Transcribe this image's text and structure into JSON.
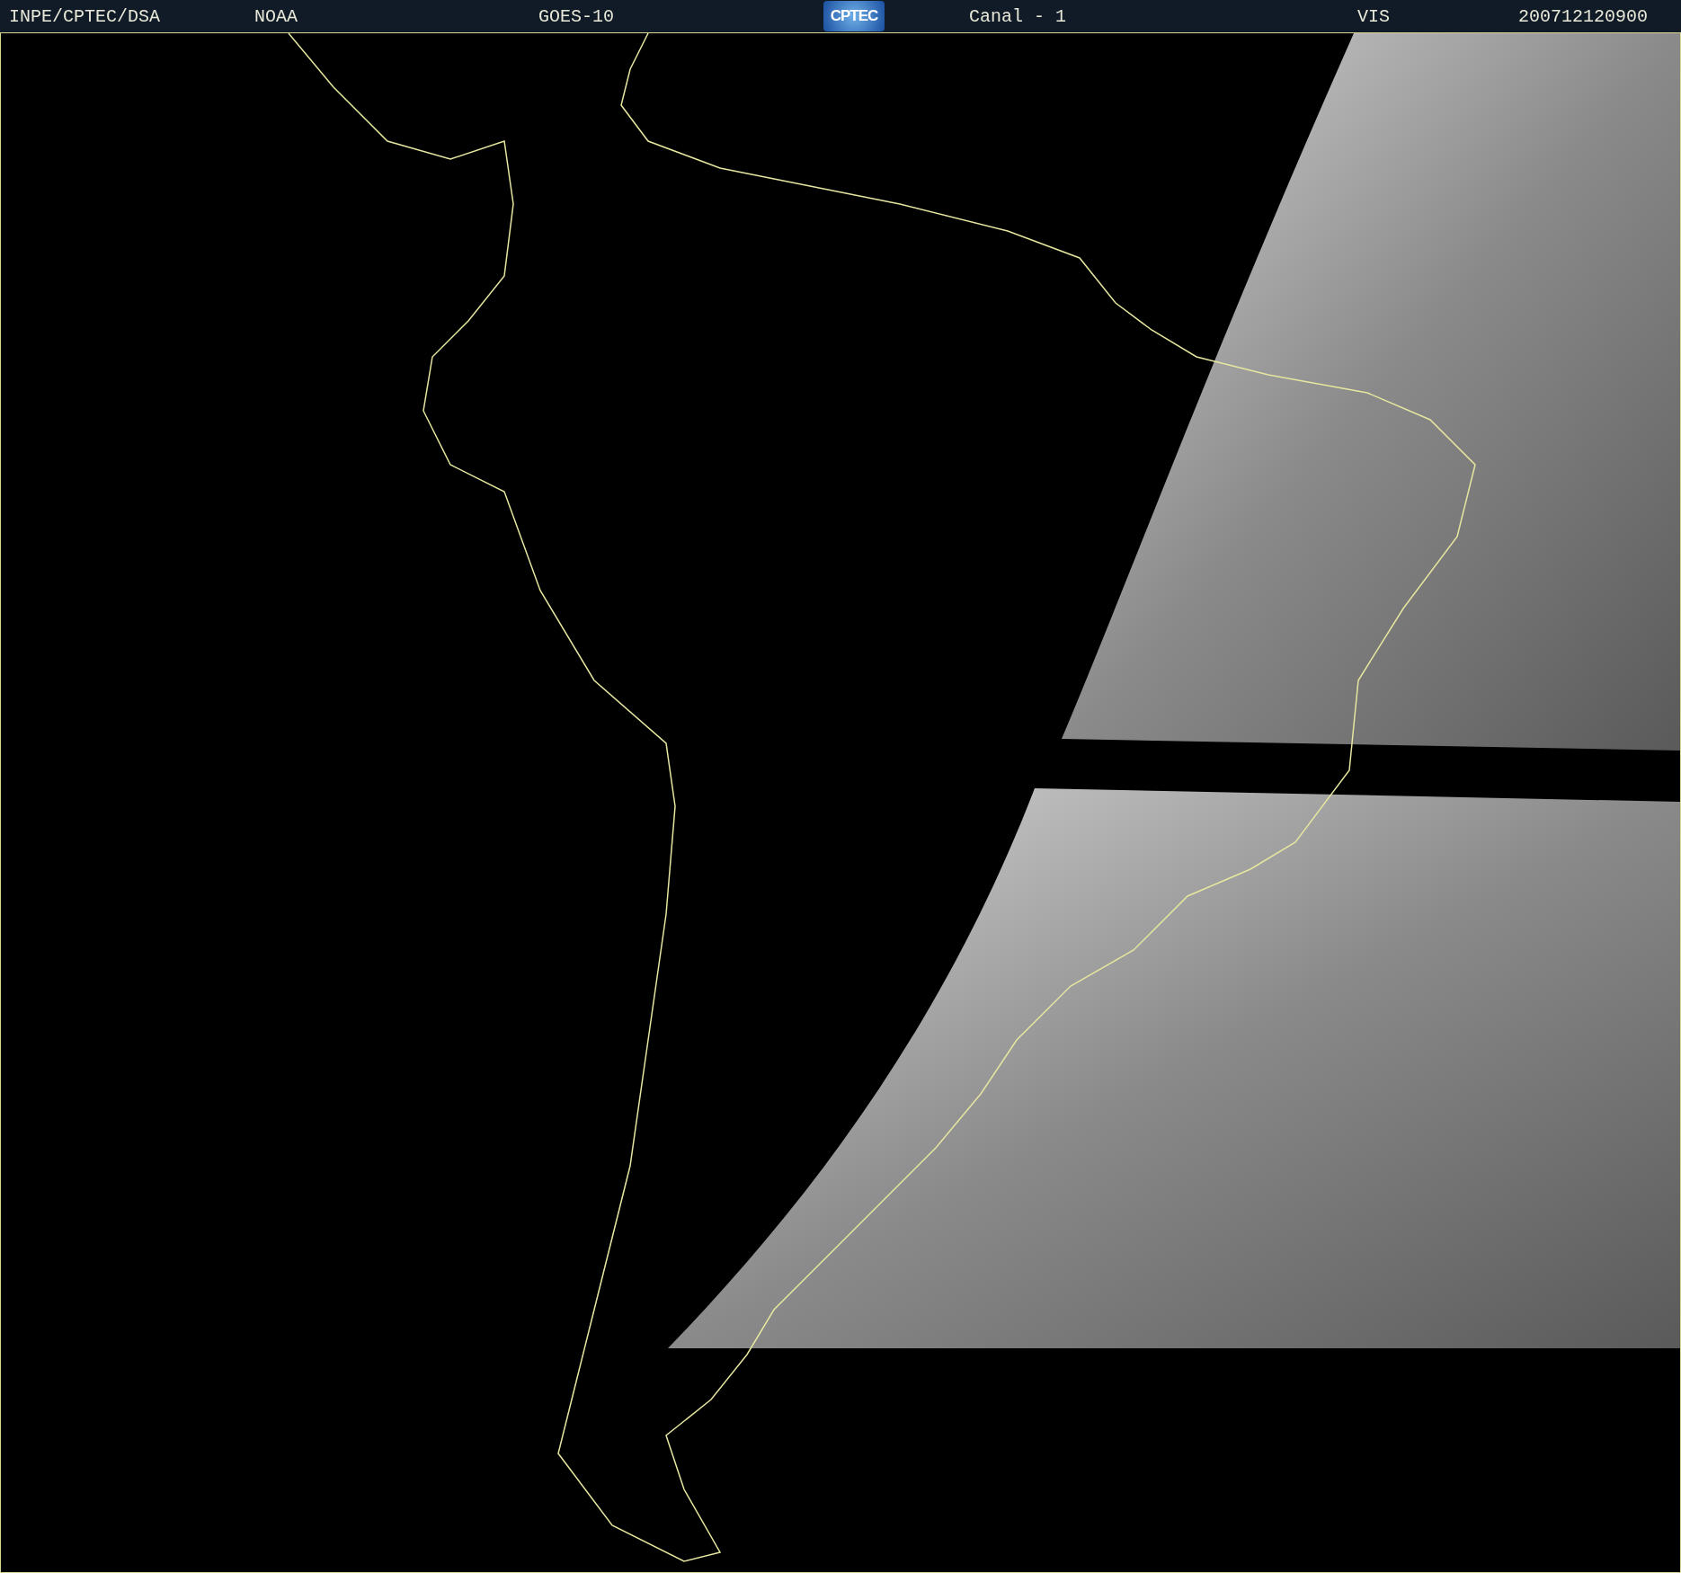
{
  "header": {
    "items": [
      {
        "kind": "text",
        "text": "INPE/CPTEC/DSA"
      },
      {
        "kind": "text",
        "text": "NOAA"
      },
      {
        "kind": "text",
        "text": "GOES-10"
      },
      {
        "kind": "logo",
        "text": "CPTEC"
      },
      {
        "kind": "text",
        "text": "Canal - 1"
      },
      {
        "kind": "text",
        "text": "VIS"
      },
      {
        "kind": "text",
        "text": "200712120900"
      }
    ]
  }
}
